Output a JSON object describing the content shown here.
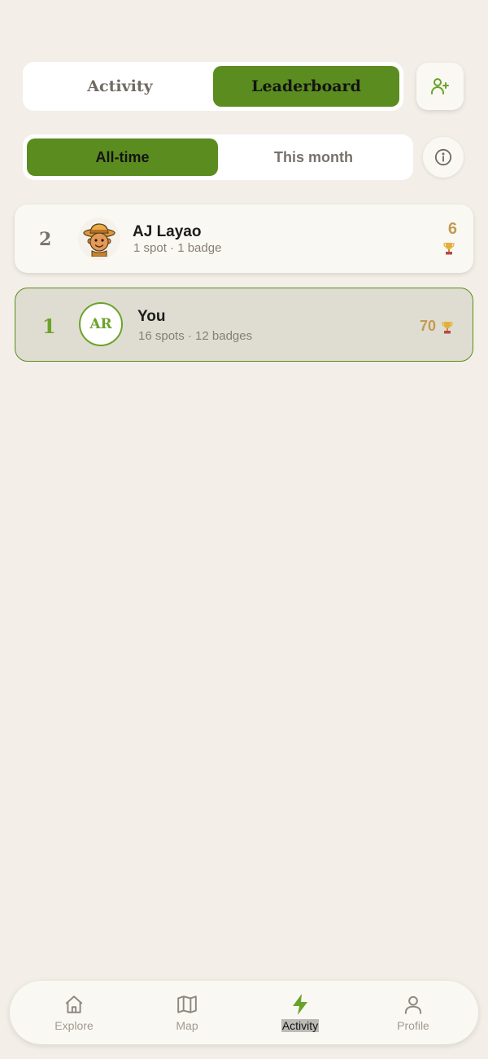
{
  "tabs": {
    "activity_label": "Activity",
    "leaderboard_label": "Leaderboard",
    "active": "Leaderboard"
  },
  "filters": {
    "all_time_label": "All-time",
    "this_month_label": "This month",
    "active": "All-time"
  },
  "icons": {
    "add_friend": "add-user-icon",
    "info": "info-icon",
    "trophy": "trophy-icon"
  },
  "leaderboard": [
    {
      "rank": "2",
      "name": "AJ Layao",
      "stats": "1 spot · 1 badge",
      "points": "6",
      "avatar": "cartoon-explorer"
    },
    {
      "rank": "1",
      "name": "You",
      "initials": "AR",
      "stats": "16 spots · 12 badges",
      "points": "70",
      "is_current_user": true
    }
  ],
  "nav": [
    {
      "label": "Explore",
      "icon": "home-icon"
    },
    {
      "label": "Map",
      "icon": "map-icon"
    },
    {
      "label": "Activity",
      "icon": "bolt-icon",
      "active": true
    },
    {
      "label": "Profile",
      "icon": "user-icon"
    }
  ],
  "colors": {
    "accent": "#5b8c1f",
    "accent_light": "#6aa32a",
    "background": "#f3efe8",
    "points": "#c49a53",
    "highlight_row": "#dfddd1"
  }
}
